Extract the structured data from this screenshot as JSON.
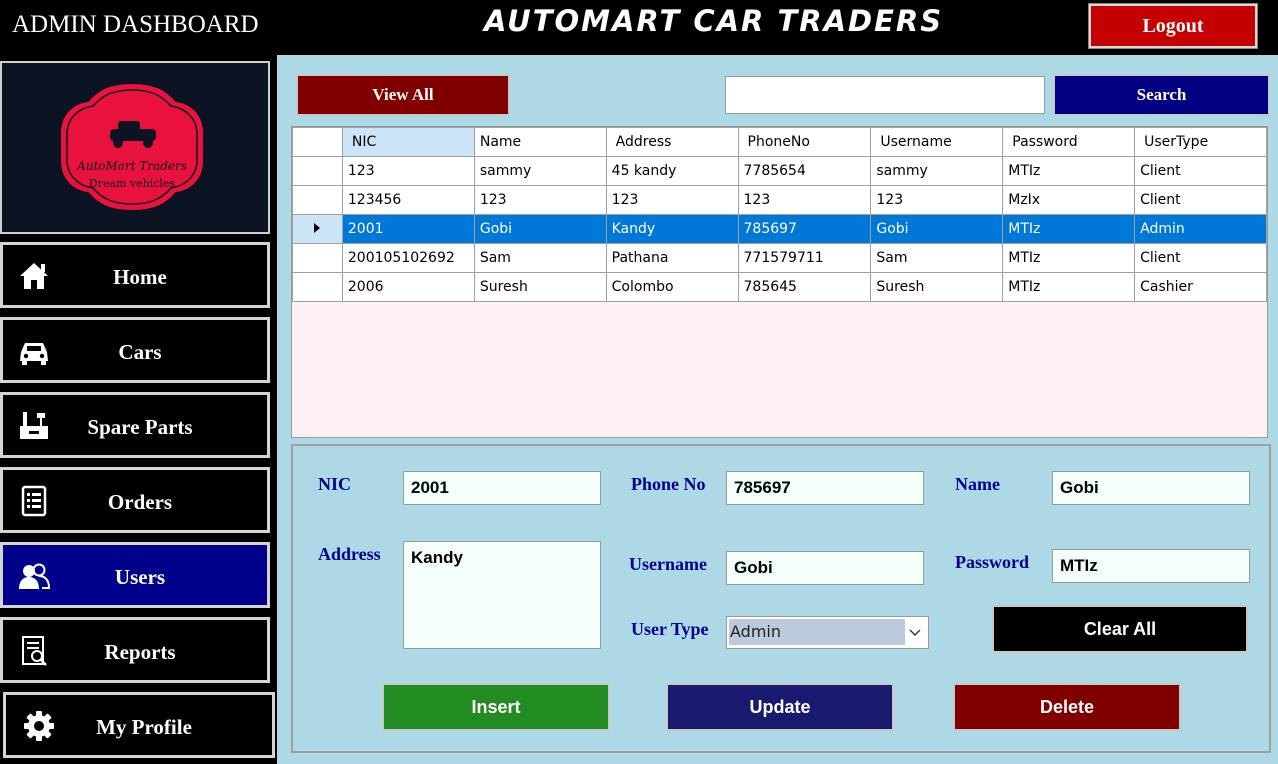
{
  "header": {
    "admin_title": "ADMIN DASHBOARD",
    "app_title": "AUTOMART CAR TRADERS",
    "logout_label": "Logout"
  },
  "logo": {
    "line1": "AutoMart Traders",
    "line2": "Dream vehicles",
    "color": "#e8123c"
  },
  "sidebar": {
    "items": [
      {
        "label": "Home",
        "icon": "home-icon"
      },
      {
        "label": "Cars",
        "icon": "car-icon"
      },
      {
        "label": "Spare Parts",
        "icon": "tools-icon"
      },
      {
        "label": "Orders",
        "icon": "orders-icon"
      },
      {
        "label": "Users",
        "icon": "users-icon",
        "active": true
      },
      {
        "label": "Reports",
        "icon": "reports-icon"
      },
      {
        "label": "My Profile",
        "icon": "gear-icon"
      }
    ]
  },
  "toolbar": {
    "view_all_label": "View All",
    "search_value": "",
    "search_label": "Search"
  },
  "grid": {
    "columns": [
      "NIC",
      "Name",
      "Address",
      "PhoneNo",
      "Username",
      "Password",
      "UserType"
    ],
    "rows": [
      [
        "123",
        "sammy",
        "45 kandy",
        "7785654",
        "sammy",
        "MTIz",
        "Client"
      ],
      [
        "123456",
        "123",
        "123",
        "123",
        "123",
        "MzIx",
        "Client"
      ],
      [
        "2001",
        "Gobi",
        "Kandy",
        "785697",
        "Gobi",
        "MTIz",
        "Admin"
      ],
      [
        "200105102692",
        "Sam",
        "Pathana",
        "771579711",
        "Sam",
        "MTIz",
        "Client"
      ],
      [
        "2006",
        "Suresh",
        "Colombo",
        "785645",
        "Suresh",
        "MTIz",
        "Cashier"
      ]
    ],
    "selected_row": 2
  },
  "form": {
    "nic_label": "NIC",
    "nic_value": "2001",
    "phone_label": "Phone No",
    "phone_value": "785697",
    "name_label": "Name",
    "name_value": "Gobi",
    "address_label": "Address",
    "address_value": "Kandy",
    "username_label": "Username",
    "username_value": "Gobi",
    "password_label": "Password",
    "password_value": "MTIz",
    "usertype_label": "User Type",
    "usertype_value": "Admin",
    "clear_label": "Clear All",
    "insert_label": "Insert",
    "update_label": "Update",
    "delete_label": "Delete"
  },
  "colors": {
    "sidebar_bg": "#000000",
    "sidebar_active": "#00008b",
    "main_bg": "#add8e6",
    "logout": "#c40000",
    "view_all": "#800000",
    "search": "#000080",
    "insert": "#228b22",
    "update": "#191970",
    "delete": "#800000",
    "selection": "#0078d7"
  }
}
